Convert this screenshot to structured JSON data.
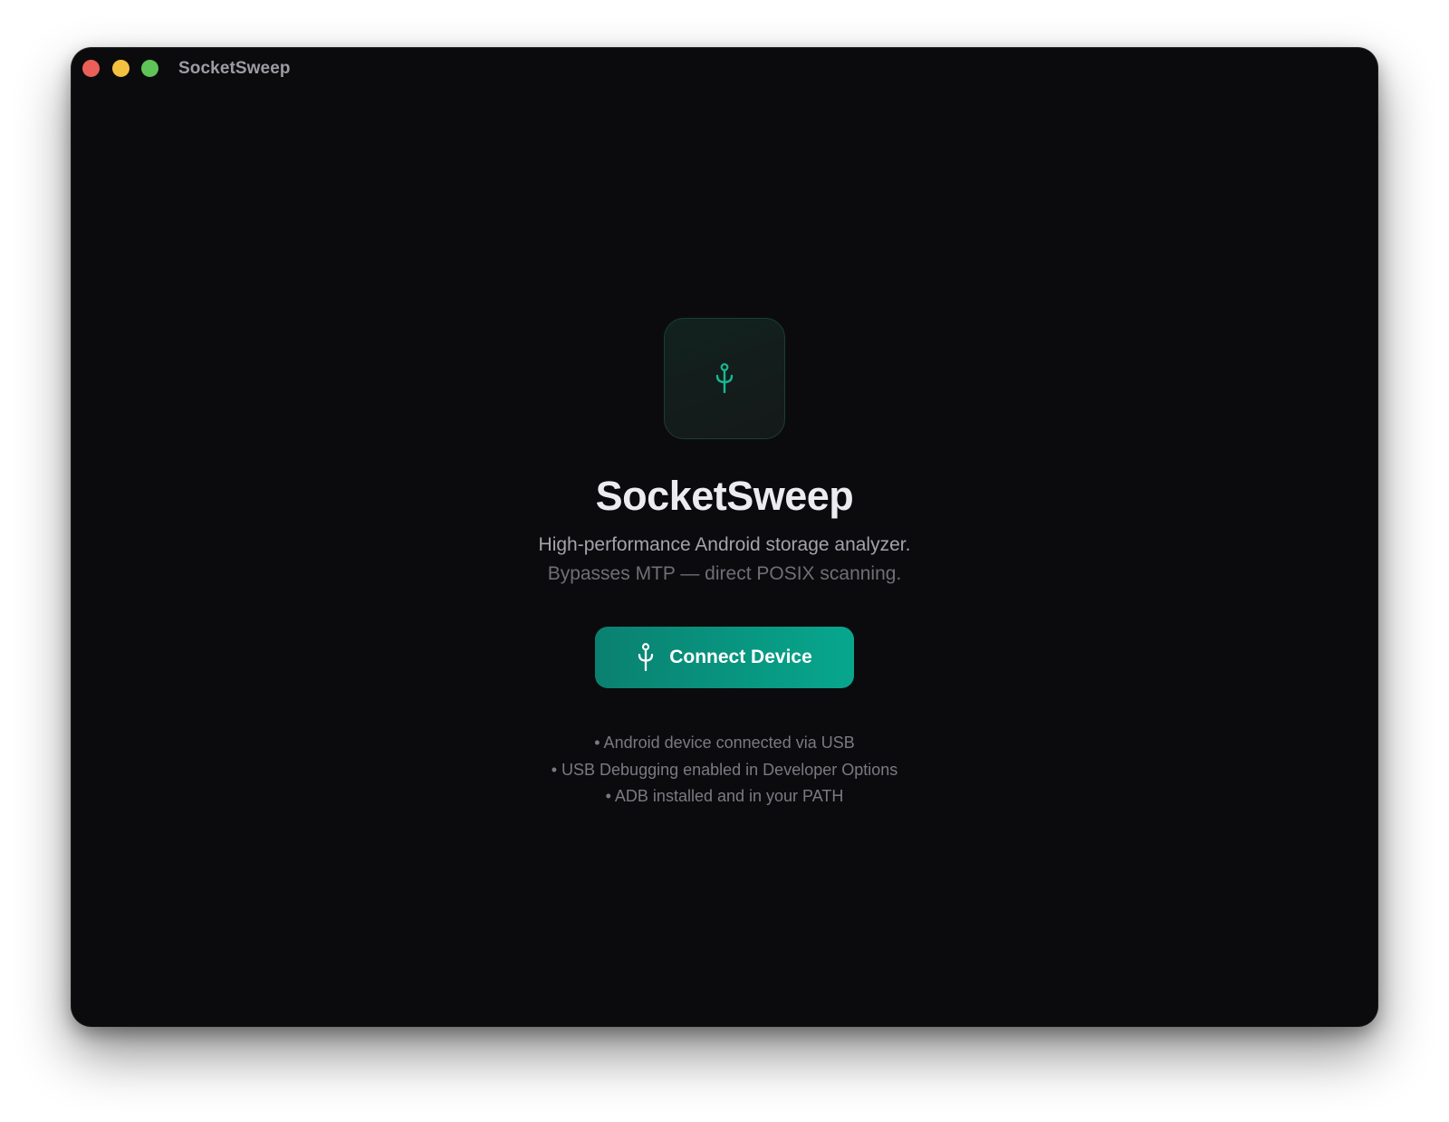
{
  "window": {
    "title": "SocketSweep"
  },
  "hero": {
    "icon": "usb-icon",
    "title": "SocketSweep",
    "tagline_line1": "High-performance Android storage analyzer.",
    "tagline_line2": "Bypasses MTP — direct POSIX scanning."
  },
  "connect_button": {
    "icon": "usb-icon",
    "label": "Connect Device"
  },
  "requirements": [
    "• Android device connected via USB",
    "• USB Debugging enabled in Developer Options",
    "• ADB installed and in your PATH"
  ],
  "colors": {
    "accent": "#07a78d",
    "accent_dark": "#0a8070",
    "window_bg": "#0b0b0d",
    "close": "#ec5f59",
    "minimize": "#f3c13f",
    "maximize": "#5fc457"
  }
}
